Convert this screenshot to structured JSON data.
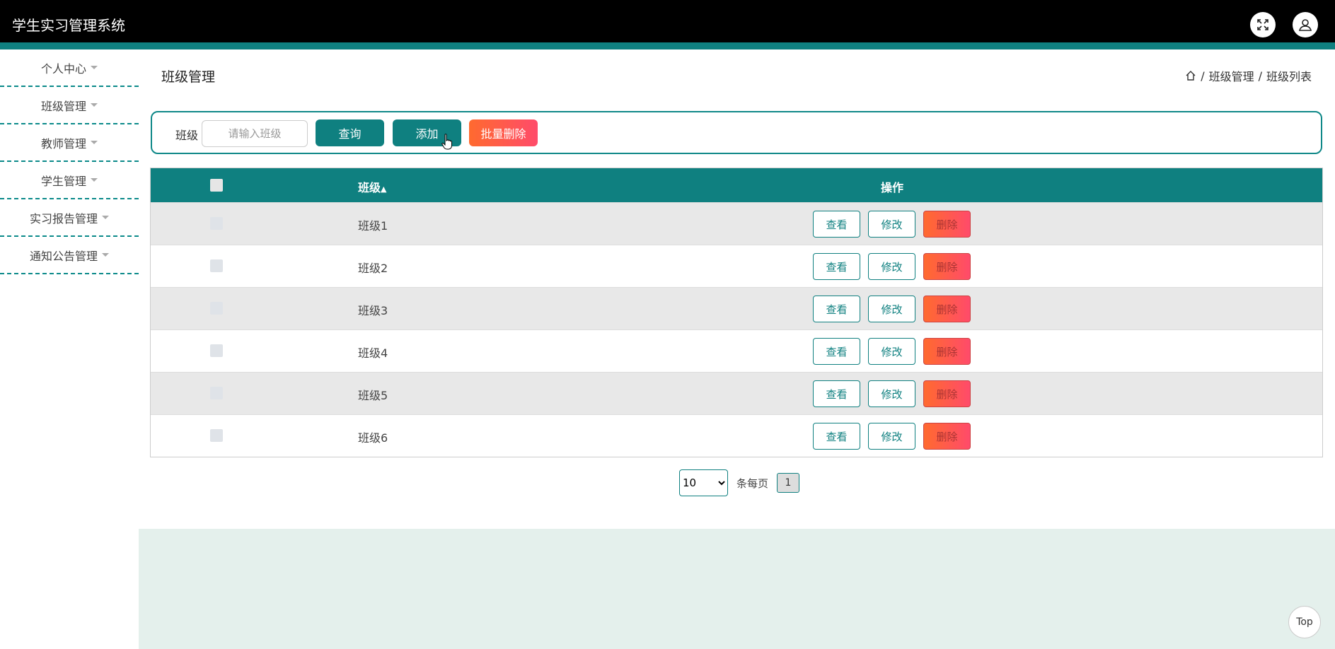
{
  "app": {
    "title": "学生实习管理系统"
  },
  "sidebar": {
    "items": [
      {
        "label": "个人中心"
      },
      {
        "label": "班级管理"
      },
      {
        "label": "教师管理"
      },
      {
        "label": "学生管理"
      },
      {
        "label": "实习报告管理"
      },
      {
        "label": "通知公告管理"
      }
    ]
  },
  "page": {
    "title": "班级管理"
  },
  "breadcrumb": {
    "section": "班级管理",
    "sep": "/",
    "current": "班级列表"
  },
  "search": {
    "label": "班级",
    "placeholder": "请输入班级",
    "value": "",
    "query_label": "查询",
    "add_label": "添加",
    "batch_delete_label": "批量删除"
  },
  "table": {
    "headers": {
      "class": "班级",
      "sort_icon": "sort-icon",
      "actions": "操作"
    },
    "rows": [
      {
        "class": "班级1"
      },
      {
        "class": "班级2"
      },
      {
        "class": "班级3"
      },
      {
        "class": "班级4"
      },
      {
        "class": "班级5"
      },
      {
        "class": "班级6"
      }
    ],
    "action_labels": {
      "view": "查看",
      "edit": "修改",
      "delete": "删除"
    }
  },
  "pagination": {
    "page_size": "10",
    "per_page_label": "条每页",
    "current_page": "1"
  },
  "back_to_top": {
    "label": "Top"
  },
  "colors": {
    "primary": "#0f8080",
    "danger": "#ff5a4a",
    "topbar": "#000000",
    "footer": "#e4f0ec"
  }
}
